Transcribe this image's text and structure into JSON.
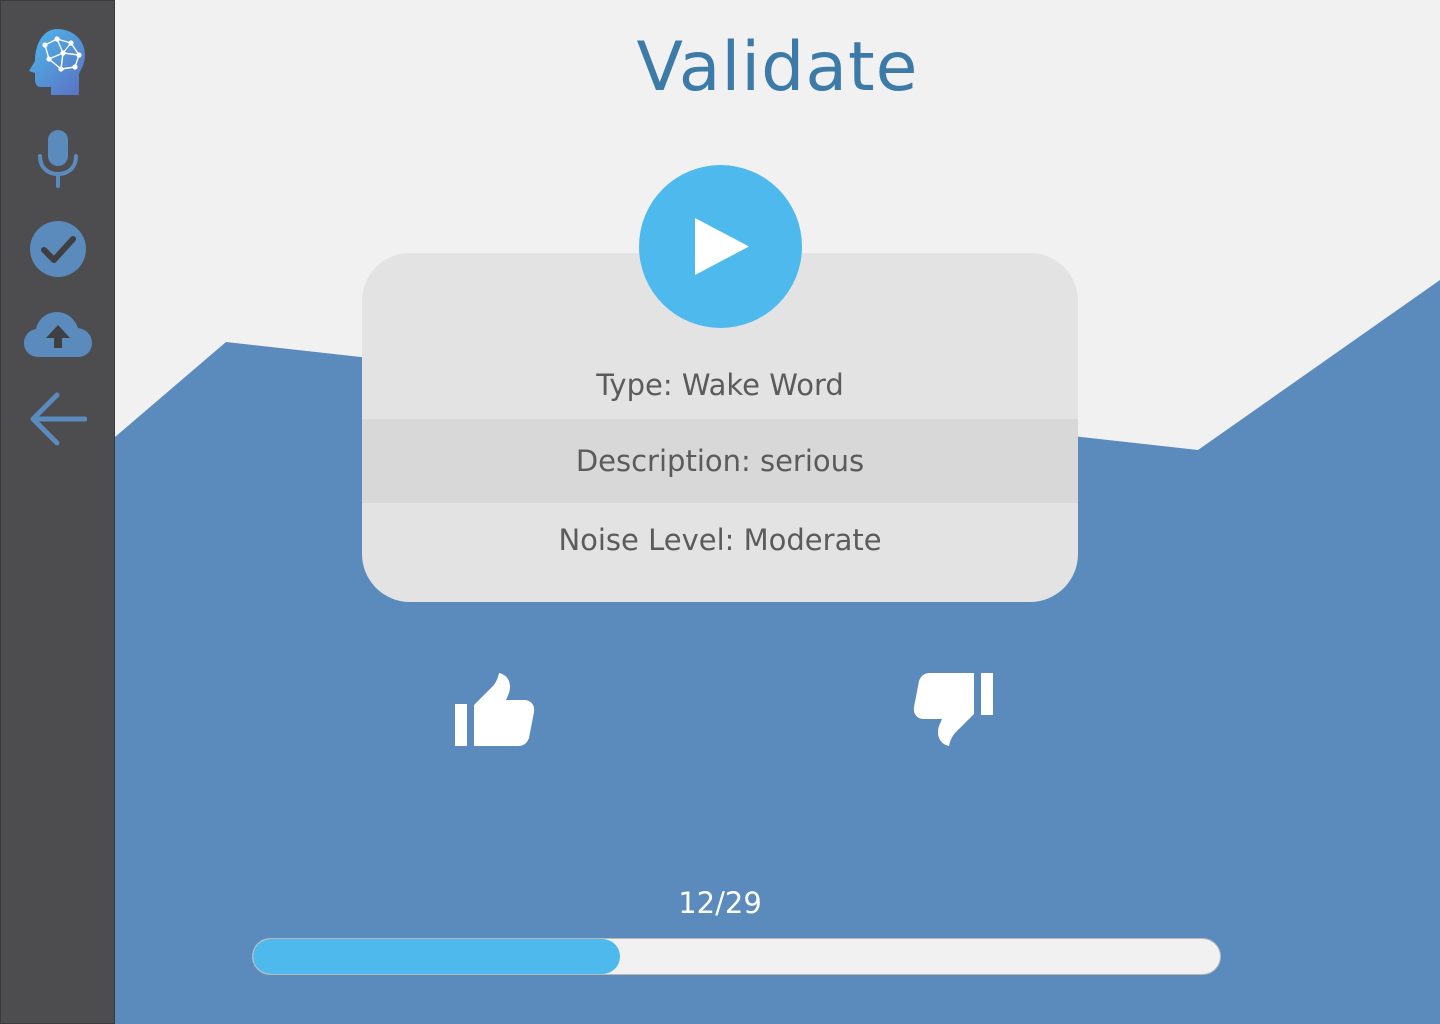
{
  "page": {
    "title": "Validate"
  },
  "sidebar": {
    "items": [
      {
        "icon": "brain-logo-icon"
      },
      {
        "icon": "microphone-icon"
      },
      {
        "icon": "check-circle-icon"
      },
      {
        "icon": "cloud-upload-icon"
      },
      {
        "icon": "arrow-left-icon"
      }
    ]
  },
  "sample": {
    "type_text": "Type:  Wake Word",
    "description_text": "Description: serious",
    "noise_text": "Noise Level:  Moderate"
  },
  "progress": {
    "label": "12/29",
    "current": 12,
    "total": 29,
    "fill_fraction": 0.38
  },
  "colors": {
    "title": "#3c7aa8",
    "accent": "#4eb9ec",
    "wave": "#5b8abd",
    "sidebar": "#4d4c4e",
    "sidebar_icon": "#5b8abd"
  }
}
